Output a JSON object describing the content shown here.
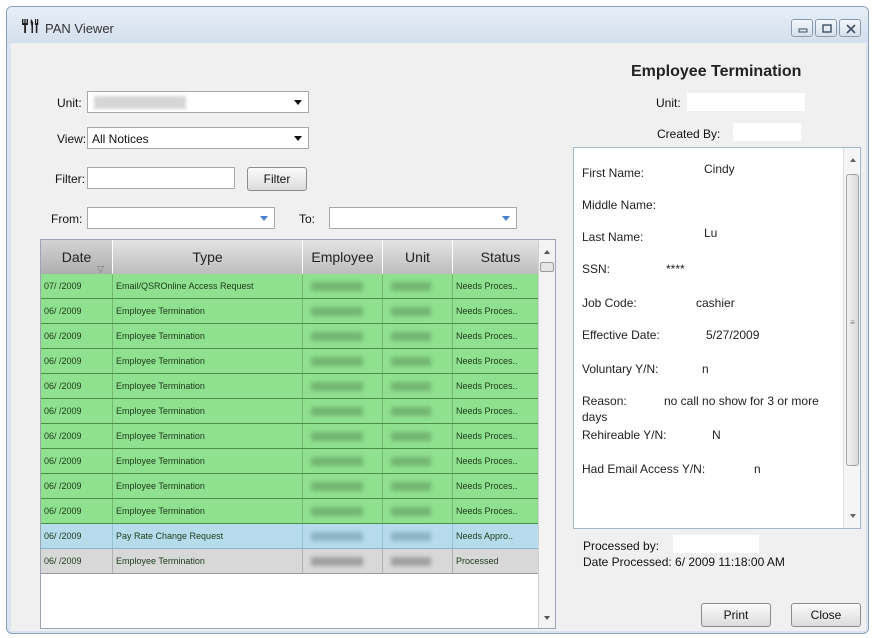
{
  "window": {
    "title": "PAN Viewer",
    "app_icon": "restaurant-utensils-icon"
  },
  "filters": {
    "unit_label": "Unit:",
    "unit_value": "",
    "view_label": "View:",
    "view_value": "All Notices",
    "filter_label": "Filter:",
    "filter_value": "",
    "filter_button": "Filter",
    "from_label": "From:",
    "from_value": "",
    "to_label": "To:",
    "to_value": ""
  },
  "grid": {
    "columns": [
      "Date",
      "Type",
      "Employee",
      "Unit",
      "Status"
    ],
    "rows": [
      {
        "date": "07/  /2009",
        "type": "Email/QSROnline Access Request",
        "status": "Needs Proces..",
        "state": "green"
      },
      {
        "date": "06/  /2009",
        "type": "Employee Termination",
        "status": "Needs Proces..",
        "state": "green"
      },
      {
        "date": "06/  /2009",
        "type": "Employee Termination",
        "status": "Needs Proces..",
        "state": "green"
      },
      {
        "date": "06/  /2009",
        "type": "Employee Termination",
        "status": "Needs Proces..",
        "state": "green"
      },
      {
        "date": "06/  /2009",
        "type": "Employee Termination",
        "status": "Needs Proces..",
        "state": "green"
      },
      {
        "date": "06/  /2009",
        "type": "Employee Termination",
        "status": "Needs Proces..",
        "state": "green"
      },
      {
        "date": "06/  /2009",
        "type": "Employee Termination",
        "status": "Needs Proces..",
        "state": "green"
      },
      {
        "date": "06/  /2009",
        "type": "Employee Termination",
        "status": "Needs Proces..",
        "state": "green"
      },
      {
        "date": "06/  /2009",
        "type": "Employee Termination",
        "status": "Needs Proces..",
        "state": "green"
      },
      {
        "date": "06/  /2009",
        "type": "Employee Termination",
        "status": "Needs Proces..",
        "state": "green"
      },
      {
        "date": "06/  /2009",
        "type": "Pay Rate Change Request",
        "status": "Needs Appro..",
        "state": "blue"
      },
      {
        "date": "06/  /2009",
        "type": "Employee Termination",
        "status": "Processed",
        "state": "grey"
      }
    ]
  },
  "detail": {
    "title": "Employee Termination",
    "unit_label": "Unit:",
    "created_by_label": "Created By:",
    "fields": [
      {
        "label": "First Name:",
        "value": "Cindy"
      },
      {
        "label": "Middle Name:",
        "value": ""
      },
      {
        "label": "Last Name:",
        "value": "Lu"
      },
      {
        "label": "SSN:",
        "value": "****"
      },
      {
        "label": "Job Code:",
        "value": "cashier"
      },
      {
        "label": "Effective Date:",
        "value": "5/27/2009"
      },
      {
        "label": "Voluntary Y/N:",
        "value": "n"
      },
      {
        "label": "Reason:",
        "value": "no call no show for 3 or more",
        "value_cont": "days"
      },
      {
        "label": "Rehireable Y/N:",
        "value": "N"
      },
      {
        "label": "Had Email Access Y/N:",
        "value": "n"
      }
    ],
    "processed_by_label": "Processed by:",
    "date_processed": "Date Processed: 6/    2009 11:18:00 AM"
  },
  "buttons": {
    "print": "Print",
    "close": "Close"
  }
}
